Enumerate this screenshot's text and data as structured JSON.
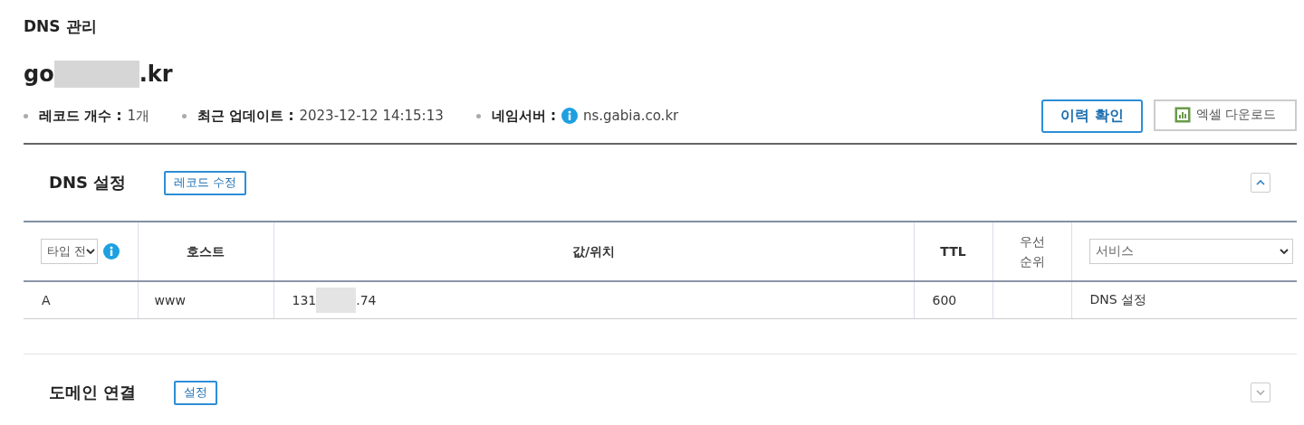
{
  "page_title": "DNS 관리",
  "domain": {
    "prefix": "go",
    "suffix": ".kr",
    "redacted": true
  },
  "meta": [
    {
      "label": "레코드 개수 :",
      "value": "1개",
      "info": false
    },
    {
      "label": "최근 업데이트 :",
      "value": "2023-12-12 14:15:13",
      "info": false
    },
    {
      "label": "네임서버 :",
      "value": "ns.gabia.co.kr",
      "info": true
    }
  ],
  "buttons": [
    {
      "label": "이력 확인",
      "kind": "primary"
    },
    {
      "label": "엑셀 다운로드",
      "kind": "excel"
    }
  ],
  "sections": [
    {
      "title": "DNS 설정",
      "button": "레코드 수정",
      "expanded": true,
      "table": {
        "type_filter": "타입 전",
        "columns": [
          "호스트",
          "값/위치",
          "TTL",
          "우선\n순위"
        ],
        "service_filter": "서비스",
        "rows": [
          {
            "type": "A",
            "host": "www",
            "value_start": "131",
            "value_end": ".74",
            "value_redacted": true,
            "ttl": "600",
            "priority": "",
            "service": "DNS 설정"
          }
        ]
      }
    },
    {
      "title": "도메인 연결",
      "button": "설정",
      "expanded": false
    }
  ]
}
